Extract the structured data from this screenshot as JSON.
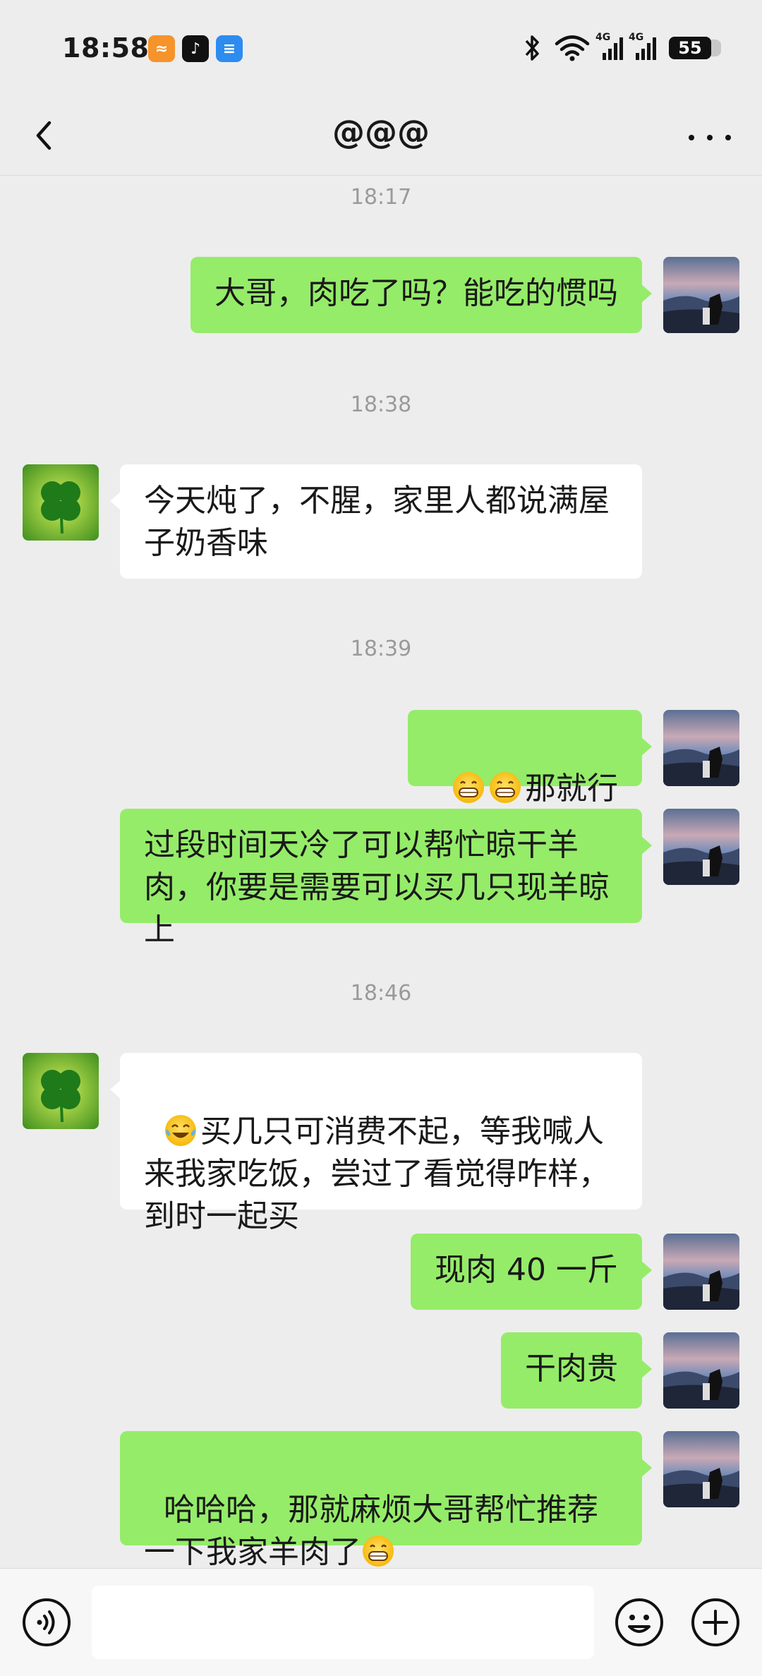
{
  "status_bar": {
    "time": "18:58",
    "battery": "55",
    "network_1": "4G",
    "network_2": "4G"
  },
  "header": {
    "title": "@@@"
  },
  "messages": [
    {
      "type": "timestamp",
      "text": "18:17"
    },
    {
      "type": "sent",
      "text": "大哥，肉吃了吗？能吃的惯吗"
    },
    {
      "type": "timestamp",
      "text": "18:38"
    },
    {
      "type": "received",
      "text": "今天炖了，不腥，家里人都说满屋子奶香味"
    },
    {
      "type": "timestamp",
      "text": "18:39"
    },
    {
      "type": "sent",
      "text": "那就行",
      "emoji_prefix": [
        "grin-emoji",
        "grin-emoji"
      ]
    },
    {
      "type": "sent",
      "text": "过段时间天冷了可以帮忙晾干羊肉，你要是需要可以买几只现羊晾上"
    },
    {
      "type": "timestamp",
      "text": "18:46"
    },
    {
      "type": "received",
      "text": "买几只可消费不起，等我喊人来我家吃饭，尝过了看觉得咋样，到时一起买",
      "emoji_prefix": [
        "tears-of-joy-emoji"
      ]
    },
    {
      "type": "sent",
      "text": "现肉 40 一斤"
    },
    {
      "type": "sent",
      "text": "干肉贵"
    },
    {
      "type": "sent",
      "text": "哈哈哈，那就麻烦大哥帮忙推荐一下我家羊肉了",
      "emoji_suffix": [
        "grin-emoji"
      ]
    }
  ],
  "input_bar": {
    "value": "",
    "placeholder": ""
  },
  "colors": {
    "sent_bubble": "#95ec69",
    "received_bubble": "#ffffff",
    "background": "#ededed"
  }
}
